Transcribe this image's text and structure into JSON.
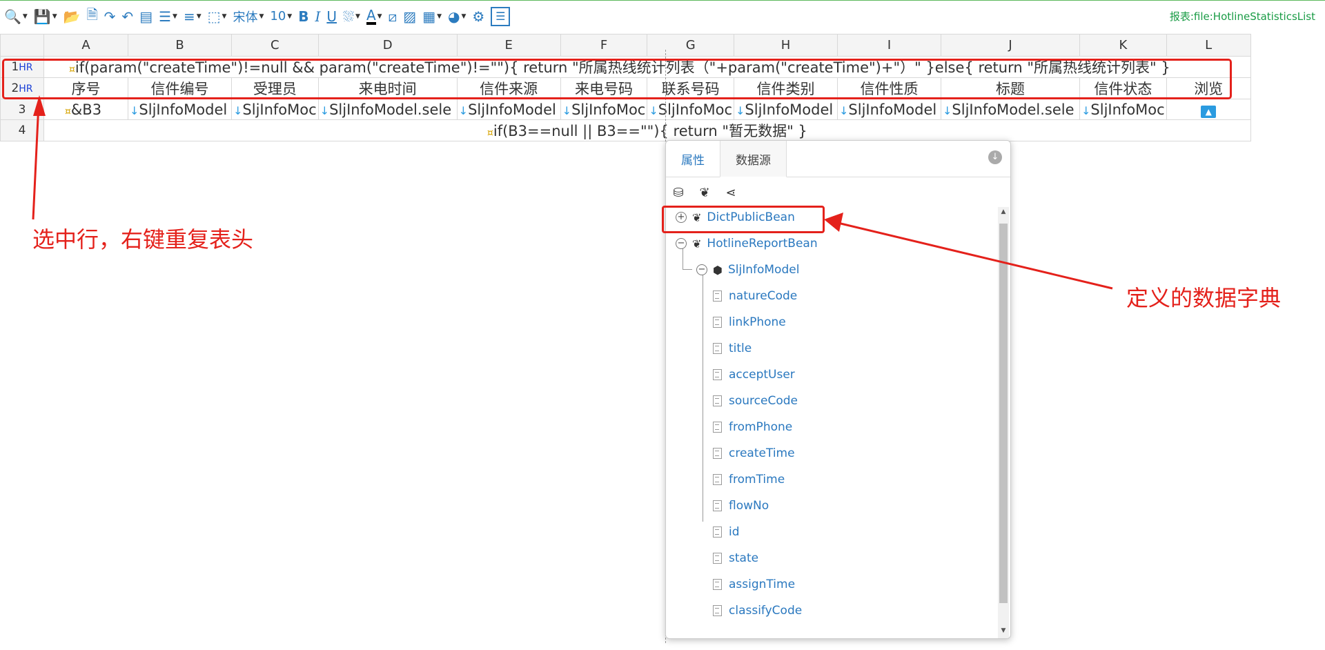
{
  "toolbar": {
    "items": [
      "preview-icon",
      "save-icon",
      "open-folder-icon",
      "export-icon",
      "redo-icon",
      "undo-icon",
      "merge-cells-icon",
      "align-icon",
      "line-height-icon",
      "border-icon"
    ],
    "font_name": "宋体",
    "font_size": "10",
    "bold": "B",
    "italic": "I",
    "underline": "U",
    "font_color_label": "A",
    "report_file": "报表:file:HotlineStatisticsList"
  },
  "grid": {
    "columns": [
      "A",
      "B",
      "C",
      "D",
      "E",
      "F",
      "G",
      "H",
      "I",
      "J",
      "K",
      "L"
    ],
    "rows": [
      {
        "num": "1",
        "tag": "HR",
        "formula": "if(param(\"createTime\")!=null && param(\"createTime\")!=\"\"){ return \"所属热线统计列表（\"+param(\"createTime\")+\"）\" }else{ return \"所属热线统计列表\" }"
      },
      {
        "num": "2",
        "tag": "HR",
        "cells": [
          "序号",
          "信件编号",
          "受理员",
          "来电时间",
          "信件来源",
          "来电号码",
          "联系号码",
          "信件类别",
          "信件性质",
          "标题",
          "信件状态",
          "浏览"
        ]
      },
      {
        "num": "3",
        "tag": "",
        "cells": [
          "&B3",
          "SljInfoModel",
          "SljInfoMoc",
          "SljInfoModel.sele",
          "SljInfoModel",
          "SljInfoMoc",
          "SljInfoMoc",
          "SljInfoModel",
          "SljInfoModel",
          "SljInfoModel.sele",
          "SljInfoMoc",
          ""
        ]
      },
      {
        "num": "4",
        "tag": "",
        "formula": "if(B3==null || B3==\"\"){ return \"暂无数据\" }"
      }
    ]
  },
  "annotations": {
    "left": "选中行，右键重复表头",
    "right": "定义的数据字典"
  },
  "panel": {
    "tabs": [
      "属性",
      "数据源"
    ],
    "active_tab": "数据源",
    "tools": [
      "database-icon",
      "leaf-icon",
      "share-icon"
    ],
    "tree": {
      "dict_bean": "DictPublicBean",
      "report_bean": "HotlineReportBean",
      "model": "SljInfoModel",
      "fields": [
        "natureCode",
        "linkPhone",
        "title",
        "acceptUser",
        "sourceCode",
        "fromPhone",
        "createTime",
        "fromTime",
        "flowNo",
        "id",
        "state",
        "assignTime",
        "classifyCode"
      ]
    }
  },
  "colors": {
    "accent": "#2a78bf",
    "highlight": "#e4211b",
    "report_file": "#1a9c46"
  }
}
